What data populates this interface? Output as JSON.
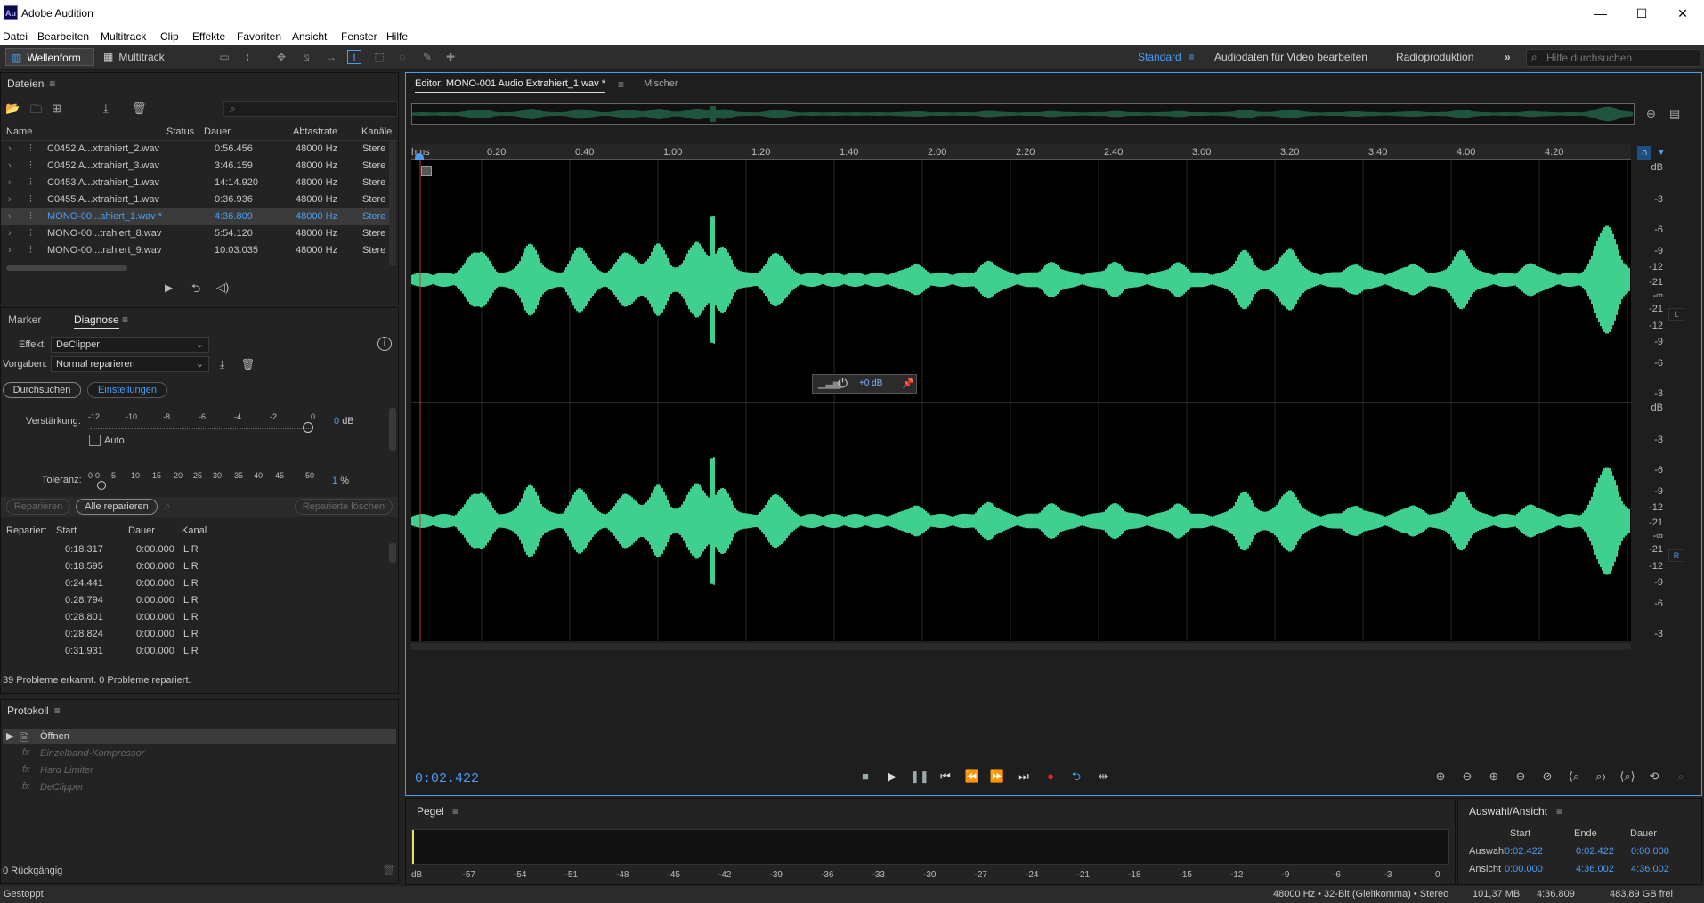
{
  "window": {
    "title": "Adobe Audition",
    "logo": "Au",
    "minimize": "—",
    "maximize": "☐",
    "close": "✕"
  },
  "menu": [
    "Datei",
    "Bearbeiten",
    "Multitrack",
    "Clip",
    "Effekte",
    "Favoriten",
    "Ansicht",
    "Fenster",
    "Hilfe"
  ],
  "toolbar": {
    "waveform_label": "Wellenform",
    "multitrack_label": "Multitrack",
    "workspaces": [
      "Standard",
      "Audiodaten für Video bearbeiten",
      "Radioproduktion"
    ],
    "more": "»",
    "search_placeholder": "Hilfe durchsuchen"
  },
  "files": {
    "title": "Dateien",
    "columns": {
      "name": "Name",
      "status": "Status",
      "duration": "Dauer",
      "rate": "Abtastrate",
      "channels": "Kanäle"
    },
    "rows": [
      {
        "name": "C0452 A...xtrahiert_2.wav",
        "duration": "0:56.456",
        "rate": "48000 Hz",
        "channels": "Stere"
      },
      {
        "name": "C0452 A...xtrahiert_3.wav",
        "duration": "3:46.159",
        "rate": "48000 Hz",
        "channels": "Stere"
      },
      {
        "name": "C0453 A...xtrahiert_1.wav",
        "duration": "14:14.920",
        "rate": "48000 Hz",
        "channels": "Stere"
      },
      {
        "name": "C0455 A...xtrahiert_1.wav",
        "duration": "0:36.936",
        "rate": "48000 Hz",
        "channels": "Stere"
      },
      {
        "name": "MONO-00...ahiert_1.wav *",
        "duration": "4:36.809",
        "rate": "48000 Hz",
        "channels": "Stere"
      },
      {
        "name": "MONO-00...trahiert_8.wav",
        "duration": "5:54.120",
        "rate": "48000 Hz",
        "channels": "Stere"
      },
      {
        "name": "MONO-00...trahiert_9.wav",
        "duration": "10:03.035",
        "rate": "48000 Hz",
        "channels": "Stere"
      }
    ]
  },
  "diagnose": {
    "tab_marker": "Marker",
    "tab_diagnose": "Diagnose",
    "effect_label": "Effekt:",
    "effect_value": "DeClipper",
    "preset_label": "Vorgaben:",
    "preset_value": "Normal reparieren",
    "scan_button": "Durchsuchen",
    "settings_button": "Einstellungen",
    "gain_label": "Verstärkung:",
    "gain_ticks": [
      "-12",
      "-10",
      "-8",
      "-6",
      "-4",
      "-2",
      "0"
    ],
    "gain_value": "0",
    "gain_unit": "dB",
    "auto_label": "Auto",
    "tolerance_label": "Toleranz:",
    "tolerance_ticks": [
      "0",
      "0",
      "5",
      "10",
      "15",
      "20",
      "25",
      "30",
      "35",
      "40",
      "45",
      "50"
    ],
    "tolerance_value": "1",
    "tolerance_unit": "%",
    "repair_button": "Reparieren",
    "repair_all_button": "Alle reparieren",
    "clear_repaired_button": "Reparierte löschen",
    "columns": {
      "repaired": "Repariert",
      "start": "Start",
      "duration": "Dauer",
      "channel": "Kanal"
    },
    "rows": [
      {
        "start": "0:18.317",
        "duration": "0:00.000",
        "channel": "L R"
      },
      {
        "start": "0:18.595",
        "duration": "0:00.000",
        "channel": "L R"
      },
      {
        "start": "0:24.441",
        "duration": "0:00.000",
        "channel": "L R"
      },
      {
        "start": "0:28.794",
        "duration": "0:00.000",
        "channel": "L R"
      },
      {
        "start": "0:28.801",
        "duration": "0:00.000",
        "channel": "L R"
      },
      {
        "start": "0:28.824",
        "duration": "0:00.000",
        "channel": "L R"
      },
      {
        "start": "0:31.931",
        "duration": "0:00.000",
        "channel": "L R"
      }
    ],
    "summary": "39 Probleme erkannt. 0 Probleme repariert."
  },
  "history": {
    "title": "Protokoll",
    "items": [
      "Öffnen",
      "Einzelband-Kompressor",
      "Hard Limiter",
      "DeClipper"
    ],
    "undo_count": "0 Rückgängig"
  },
  "editor": {
    "tab_editor": "Editor: MONO-001 Audio Extrahiert_1.wav *",
    "tab_mixer": "Mischer",
    "ruler_unit": "hms",
    "ruler_labels": [
      "0:20",
      "0:40",
      "1:00",
      "1:20",
      "1:40",
      "2:00",
      "2:20",
      "2:40",
      "3:00",
      "3:20",
      "3:40",
      "4:00",
      "4:20"
    ],
    "db_unit": "dB",
    "db_labels_top": [
      "-3",
      "-6",
      "-9",
      "-12",
      "-21",
      "-∞",
      "-21",
      "-12",
      "-9",
      "-6",
      "-3"
    ],
    "db_labels_bottom": [
      "-3",
      "-6",
      "-9",
      "-12",
      "-21",
      "-∞",
      "-21",
      "-12",
      "-9",
      "-6",
      "-3"
    ],
    "channel_left": "L",
    "channel_right": "R",
    "hud_gain": "+0 dB",
    "current_time": "0:02.422",
    "waveform_color": "#3fd08f"
  },
  "levels": {
    "title": "Pegel",
    "scale": [
      "dB",
      "-57",
      "-54",
      "-51",
      "-48",
      "-45",
      "-42",
      "-39",
      "-36",
      "-33",
      "-30",
      "-27",
      "-24",
      "-21",
      "-18",
      "-15",
      "-12",
      "-9",
      "-6",
      "-3",
      "0"
    ]
  },
  "selection": {
    "title": "Auswahl/Ansicht",
    "col_start": "Start",
    "col_end": "Ende",
    "col_duration": "Dauer",
    "row_selection": "Auswahl",
    "row_view": "Ansicht",
    "sel_start": "0:02.422",
    "sel_end": "0:02.422",
    "sel_duration": "0:00.000",
    "view_start": "0:00.000",
    "view_end": "4:36.002",
    "view_duration": "4:36.002"
  },
  "status": {
    "state": "Gestoppt",
    "format": "48000 Hz • 32-Bit (Gleitkomma) • Stereo",
    "size": "101,37 MB",
    "duration": "4:36.809",
    "free": "483,89 GB frei"
  }
}
